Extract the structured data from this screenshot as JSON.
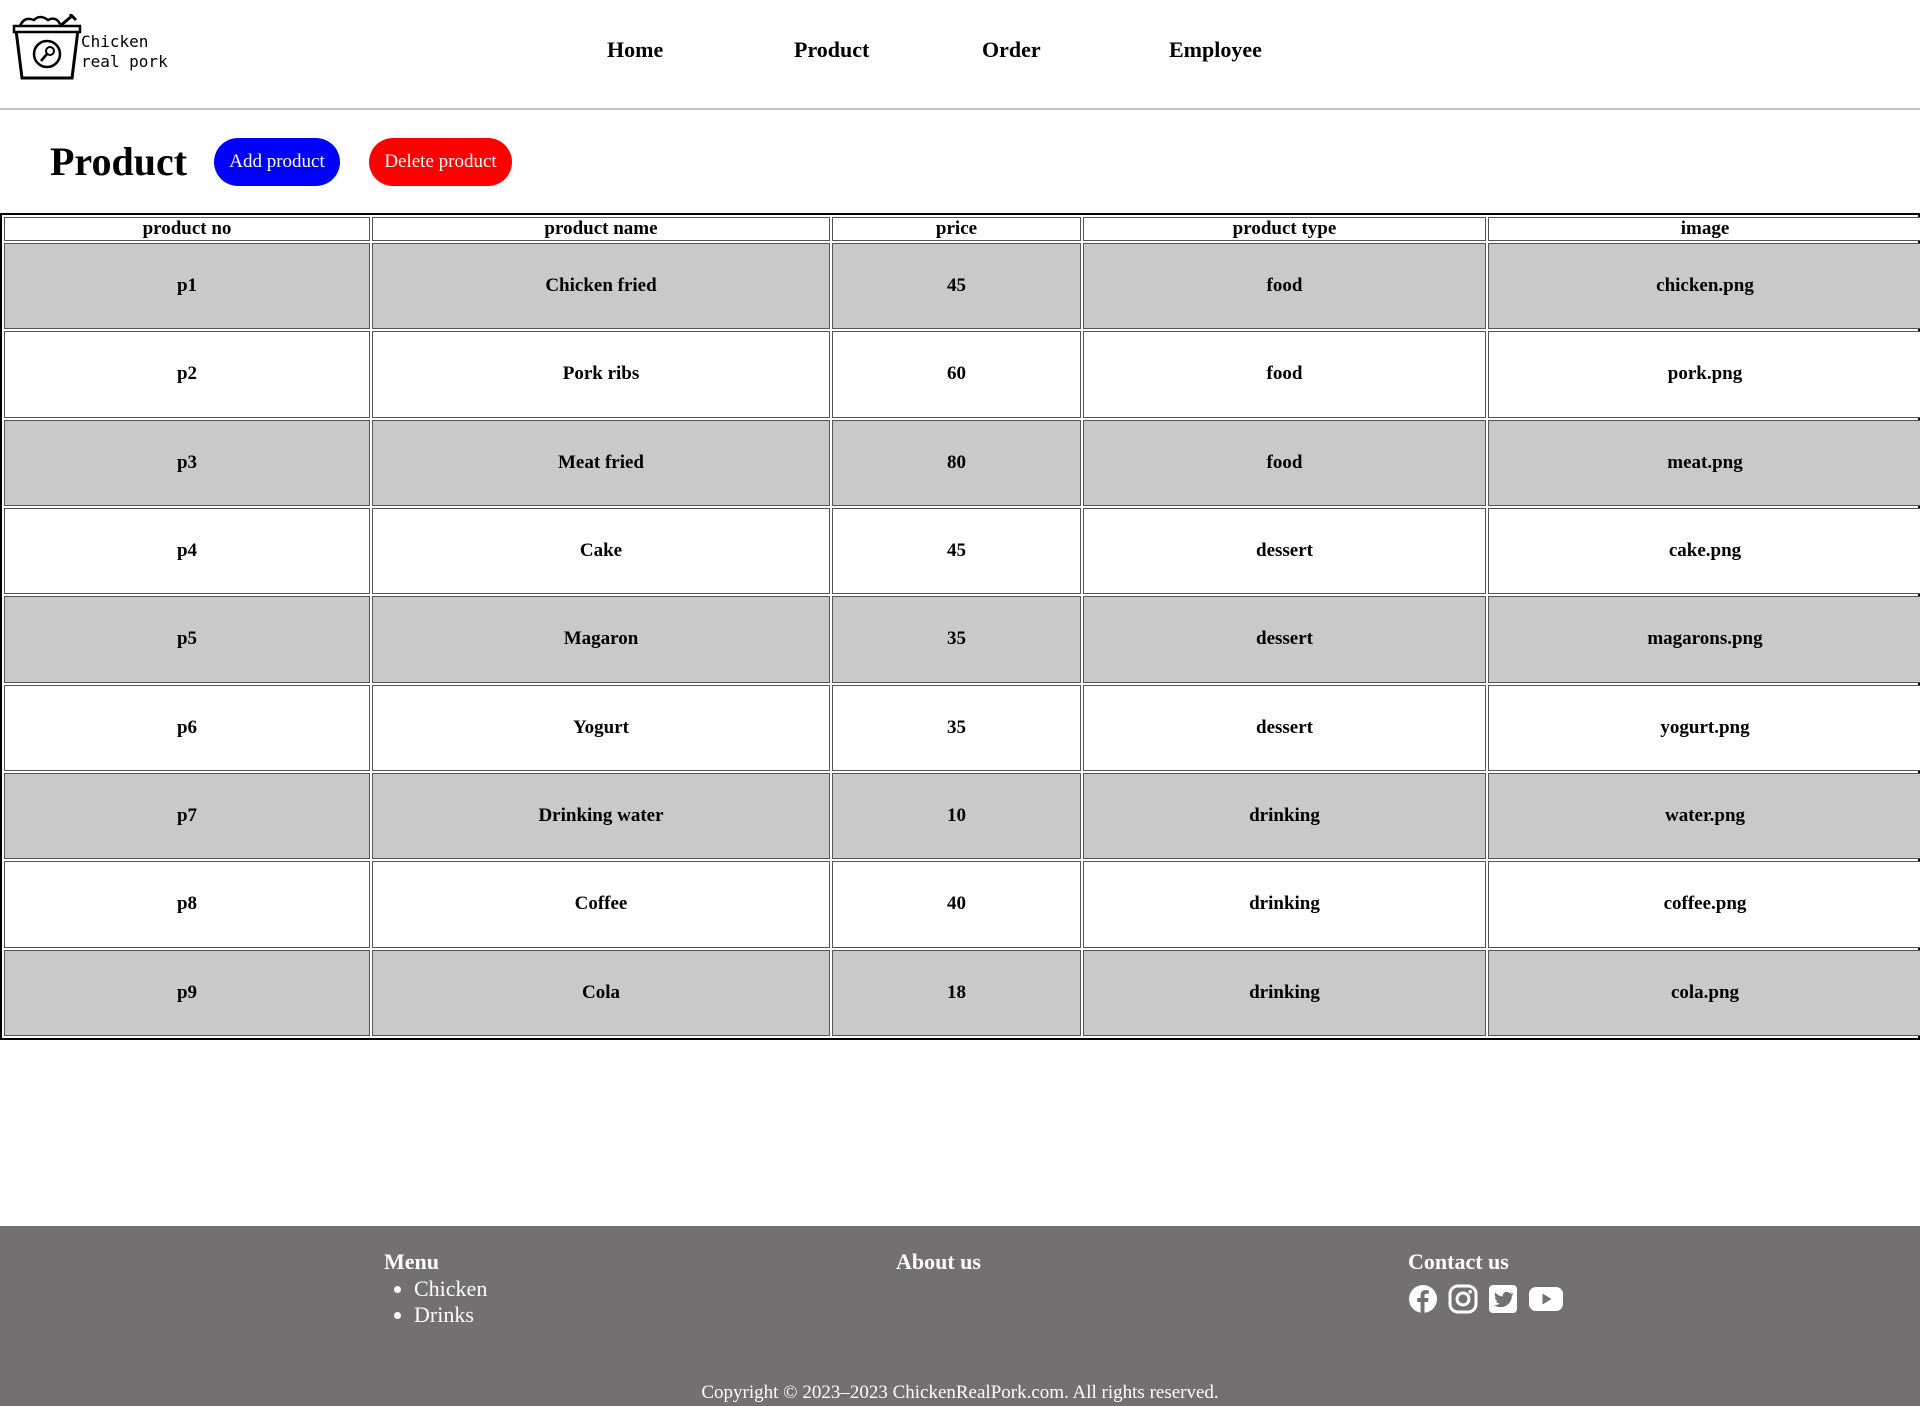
{
  "header": {
    "logo_line1": "Chicken",
    "logo_line2": "real pork",
    "nav": [
      "Home",
      "Product",
      "Order",
      "Employee"
    ]
  },
  "page": {
    "title": "Product",
    "add_label": "Add product",
    "delete_label": "Delete product"
  },
  "table": {
    "columns": [
      "product no",
      "product name",
      "price",
      "product type",
      "image"
    ],
    "rows": [
      [
        "p1",
        "Chicken fried",
        "45",
        "food",
        "chicken.png"
      ],
      [
        "p2",
        "Pork ribs",
        "60",
        "food",
        "pork.png"
      ],
      [
        "p3",
        "Meat fried",
        "80",
        "food",
        "meat.png"
      ],
      [
        "p4",
        "Cake",
        "45",
        "dessert",
        "cake.png"
      ],
      [
        "p5",
        "Magaron",
        "35",
        "dessert",
        "magarons.png"
      ],
      [
        "p6",
        "Yogurt",
        "35",
        "dessert",
        "yogurt.png"
      ],
      [
        "p7",
        "Drinking water",
        "10",
        "drinking",
        "water.png"
      ],
      [
        "p8",
        "Coffee",
        "40",
        "drinking",
        "coffee.png"
      ],
      [
        "p9",
        "Cola",
        "18",
        "drinking",
        "cola.png"
      ]
    ]
  },
  "footer": {
    "menu_title": "Menu",
    "menu_items": [
      "Chicken",
      "Drinks"
    ],
    "about_title": "About us",
    "contact_title": "Contact us",
    "social_icons": [
      "facebook-icon",
      "instagram-icon",
      "twitter-icon",
      "youtube-icon"
    ],
    "copyright": "Copyright © 2023–2023 ChickenRealPork.com. All rights reserved."
  },
  "colors": {
    "add_button": "#0000ff",
    "delete_button": "#ff0000",
    "row_stripe": "#c9c9c9",
    "footer_bg": "#727071"
  }
}
